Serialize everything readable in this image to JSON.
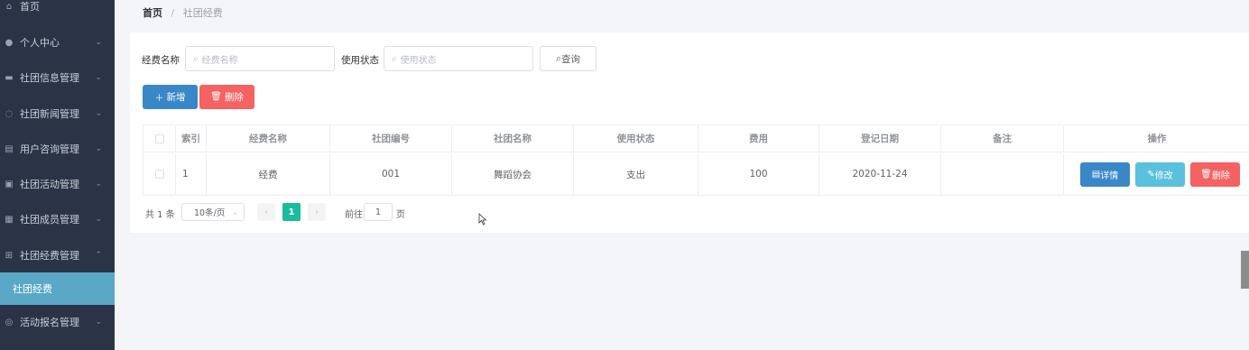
{
  "sidebar": {
    "items": [
      {
        "label": "首页",
        "icon": "home-icon",
        "glyph": "⌂",
        "has_chevron": false
      },
      {
        "label": "个人中心",
        "icon": "user-icon",
        "glyph": "●",
        "has_chevron": true
      },
      {
        "label": "社团信息管理",
        "icon": "briefcase-icon",
        "glyph": "▬",
        "has_chevron": true
      },
      {
        "label": "社团新闻管理",
        "icon": "power-icon",
        "glyph": "◌",
        "has_chevron": true
      },
      {
        "label": "用户咨询管理",
        "icon": "document-icon",
        "glyph": "▤",
        "has_chevron": true
      },
      {
        "label": "社团活动管理",
        "icon": "chair-icon",
        "glyph": "▣",
        "has_chevron": true
      },
      {
        "label": "社团成员管理",
        "icon": "monitor-icon",
        "glyph": "▦",
        "has_chevron": true
      },
      {
        "label": "社团经费管理",
        "icon": "grid-icon",
        "glyph": "⊞",
        "has_chevron": true,
        "expanded": true
      },
      {
        "label": "活动报名管理",
        "icon": "globe-icon",
        "glyph": "◎",
        "has_chevron": true
      }
    ],
    "active_sub": "社团经费"
  },
  "breadcrumb": {
    "home": "首页",
    "sep": "/",
    "current": "社团经费"
  },
  "search": {
    "name_label": "经费名称",
    "name_placeholder": "经费名称",
    "status_label": "使用状态",
    "status_placeholder": "使用状态",
    "query_label": "查询"
  },
  "actions": {
    "add_label": "新增",
    "delete_label": "删除"
  },
  "table": {
    "headers": [
      "索引",
      "经费名称",
      "社团编号",
      "社团名称",
      "使用状态",
      "费用",
      "登记日期",
      "备注",
      "操作"
    ],
    "rows": [
      {
        "index": "1",
        "name": "经费",
        "club_no": "001",
        "club_name": "舞蹈协会",
        "status": "支出",
        "cost": "100",
        "date": "2020-11-24",
        "note": ""
      }
    ],
    "row_actions": {
      "detail": "详情",
      "edit": "修改",
      "delete": "删除"
    }
  },
  "pagination": {
    "total": "共 1 条",
    "page_size": "10条/页",
    "current_page": "1",
    "goto_label": "前往",
    "goto_value": "1",
    "page_suffix": "页"
  },
  "colors": {
    "sidebar_bg": "#2b3447",
    "active_sub": "#5aa8c6",
    "primary": "#3a87c8",
    "danger": "#f56262",
    "info": "#5bc0de",
    "pager_active": "#1abc9c"
  }
}
